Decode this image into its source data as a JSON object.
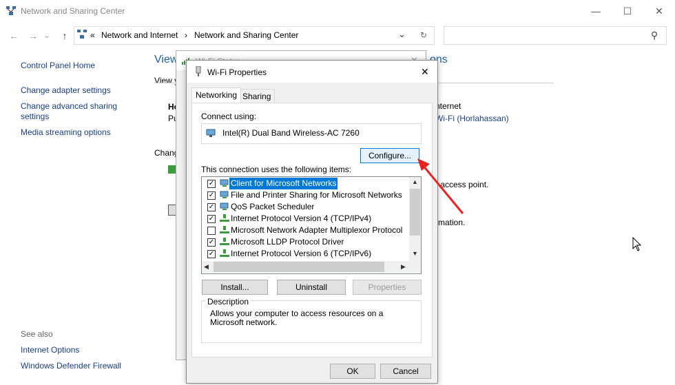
{
  "window": {
    "title": "Network and Sharing Center",
    "minimize": "—",
    "maximize": "☐",
    "close": "✕"
  },
  "nav": {
    "back": "←",
    "forward": "→",
    "dropdown": "⌄",
    "up": "↑",
    "breadcrumb_sep": "«",
    "crumb1": "Network and Internet",
    "crumb_arrow": "›",
    "crumb2": "Network and Sharing Center",
    "addr_dropdown": "⌄",
    "refresh": "↻",
    "search_placeholder": "",
    "search_icon": "⚲"
  },
  "left_pane": {
    "home": "Control Panel Home",
    "adapter": "Change adapter settings",
    "advanced_line1": "Change advanced sharing",
    "advanced_line2": "settings",
    "media": "Media streaming options",
    "see_also": "See also",
    "internet_options": "Internet Options",
    "firewall": "Windows Defender Firewall"
  },
  "background": {
    "heading_partial": "View",
    "heading_right": "ons",
    "view_partial": "View y",
    "ho_partial": "Ho",
    "pu_partial": "Pu",
    "internet": "nternet",
    "wifi_link": "Wi-Fi (Horlahassan)",
    "change_partial": "Chang",
    "access_point": "r access point.",
    "information": "rmation."
  },
  "status_dialog": {
    "title": "Wi-Fi Status",
    "close": "✕"
  },
  "properties_dialog": {
    "title": "Wi-Fi Properties",
    "close": "✕",
    "tabs": [
      "Networking",
      "Sharing"
    ],
    "connect_using_label": "Connect using:",
    "adapter_name": "Intel(R) Dual Band Wireless-AC 7260",
    "configure": "Configure...",
    "items_label": "This connection uses the following items:",
    "items": [
      {
        "label": "Client for Microsoft Networks",
        "checked": true,
        "selected": true,
        "icon": "network-client-icon"
      },
      {
        "label": "File and Printer Sharing for Microsoft Networks",
        "checked": true,
        "selected": false,
        "icon": "network-service-icon"
      },
      {
        "label": "QoS Packet Scheduler",
        "checked": true,
        "selected": false,
        "icon": "network-service-icon"
      },
      {
        "label": "Internet Protocol Version 4 (TCP/IPv4)",
        "checked": true,
        "selected": false,
        "icon": "protocol-icon"
      },
      {
        "label": "Microsoft Network Adapter Multiplexor Protocol",
        "checked": false,
        "selected": false,
        "icon": "protocol-icon"
      },
      {
        "label": "Microsoft LLDP Protocol Driver",
        "checked": true,
        "selected": false,
        "icon": "protocol-icon"
      },
      {
        "label": "Internet Protocol Version 6 (TCP/IPv6)",
        "checked": true,
        "selected": false,
        "icon": "protocol-icon"
      }
    ],
    "scroll_up": "▲",
    "scroll_down": "▼",
    "scroll_left": "◀",
    "scroll_right": "▶",
    "install": "Install...",
    "uninstall": "Uninstall",
    "properties": "Properties",
    "description_label": "Description",
    "description_text": "Allows your computer to access resources on a Microsoft network.",
    "ok": "OK",
    "cancel": "Cancel"
  },
  "colors": {
    "link": "#1a3f8f",
    "selection": "#0078d7",
    "annotation_arrow": "#e8231f"
  }
}
